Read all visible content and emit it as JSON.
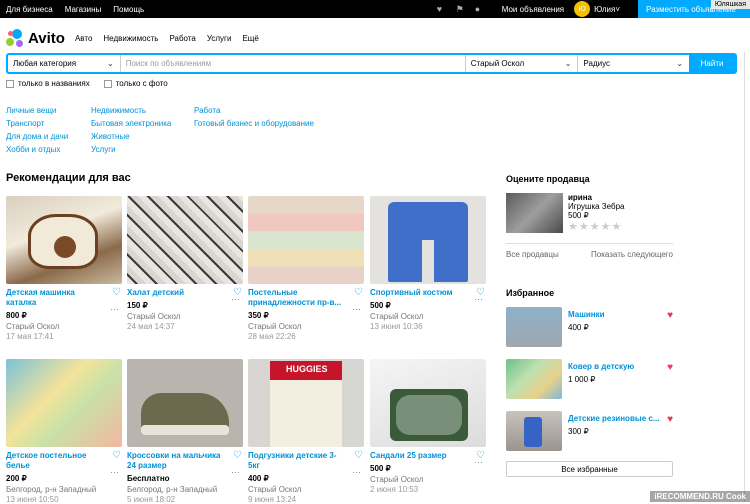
{
  "topbar": {
    "links": [
      "Для бизнеса",
      "Магазины",
      "Помощь"
    ],
    "my_ads": "Мои объявления",
    "avatar_initials": "Ю",
    "user": "Юлия",
    "post_button": "Разместить объявление",
    "corner_label": "Юляшкая"
  },
  "logo": {
    "text": "Avito"
  },
  "nav": [
    "Авто",
    "Недвижимость",
    "Работа",
    "Услуги",
    "Ещё"
  ],
  "search": {
    "category": "Любая категория",
    "placeholder": "Поиск по объявлениям",
    "city": "Старый Оскол",
    "radius": "Радиус",
    "button": "Найти"
  },
  "checks": [
    "только в названиях",
    "только с фото"
  ],
  "categories": [
    [
      "Личные вещи",
      "Транспорт",
      "Для дома и дачи",
      "Хобби и отдых"
    ],
    [
      "Недвижимость",
      "Бытовая электроника",
      "Животные",
      "Услуги"
    ],
    [
      "Работа",
      "Готовый бизнес и оборудование"
    ]
  ],
  "recommendations": {
    "title": "Рекомендации для вас",
    "items": [
      {
        "title": "Детская машинка каталка",
        "price": "800 ₽",
        "loc": "Старый Оскол",
        "date": "17 мая 17:41"
      },
      {
        "title": "Халат детский",
        "price": "150 ₽",
        "loc": "Старый Оскол",
        "date": "24 мая 14:37"
      },
      {
        "title": "Постельные принадлежности пр-в...",
        "price": "350 ₽",
        "loc": "Старый Оскол",
        "date": "28 мая 22:26"
      },
      {
        "title": "Спортивный костюм",
        "price": "500 ₽",
        "loc": "Старый Оскол",
        "date": "13 июня 10:36"
      },
      {
        "title": "Детское постельное белье",
        "price": "200 ₽",
        "loc": "Белгород, р-н Западный",
        "date": "13 июня 10:50"
      },
      {
        "title": "Кроссовки на мальчика 24 размер",
        "price": "Бесплатно",
        "loc": "Белгород, р-н Западный",
        "date": "5 июня 18:02"
      },
      {
        "title": "Подгузники детские 3-5кг",
        "price": "400 ₽",
        "loc": "Старый Оскол",
        "date": "9 июня 13:24"
      },
      {
        "title": "Сандали 25 размер",
        "price": "500 ₽",
        "loc": "Старый Оскол",
        "date": "2 июня 10:53"
      }
    ]
  },
  "rate_seller": {
    "title": "Оцените продавца",
    "name": "ирина",
    "item": "Игрушка Зебра",
    "price": "500 ₽",
    "stars": "★★★★★",
    "all_sellers": "Все продавцы",
    "next": "Показать следующего"
  },
  "favorites": {
    "title": "Избранное",
    "items": [
      {
        "title": "Машинки",
        "price": "400 ₽"
      },
      {
        "title": "Ковер в детскую",
        "price": "1 000 ₽"
      },
      {
        "title": "Детские резиновые с...",
        "price": "300 ₽"
      }
    ],
    "all_button": "Все избранные"
  },
  "watermark": "iRECOMMEND.RU",
  "cut_text": "Cook"
}
